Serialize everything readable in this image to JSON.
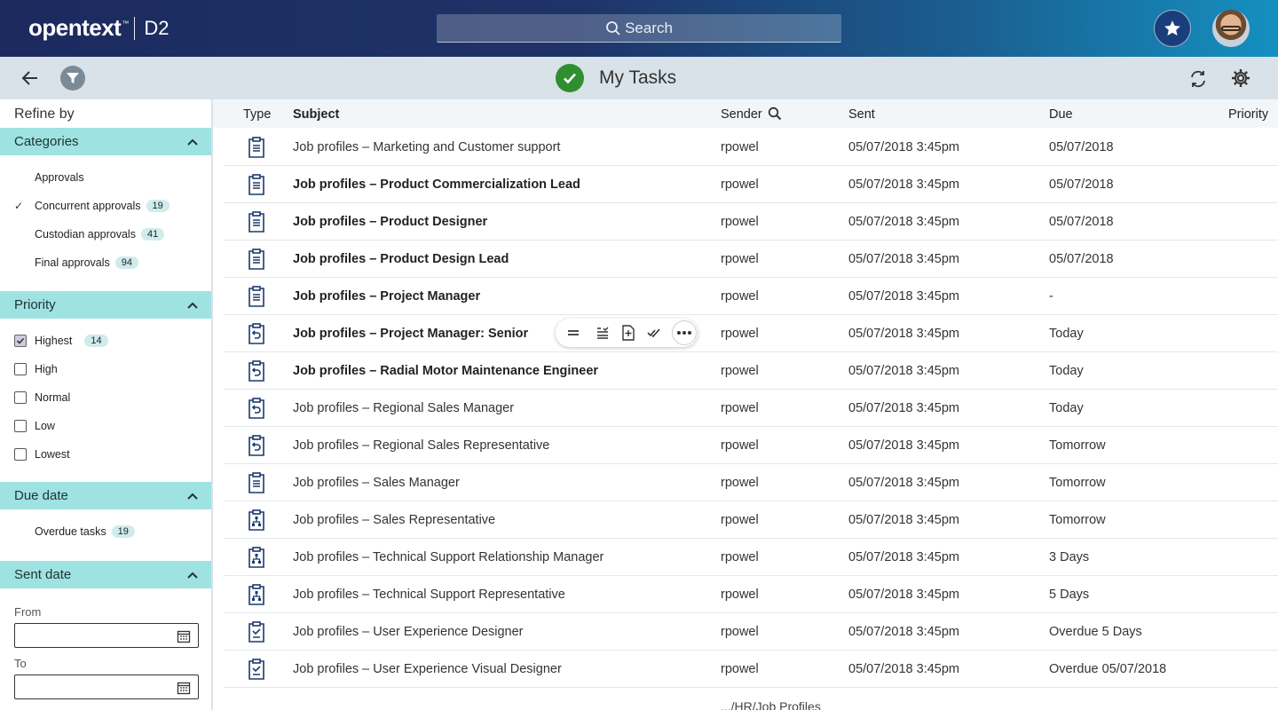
{
  "header": {
    "brand": "opentext",
    "trademark": "™",
    "product": "D2",
    "search_placeholder": "Search"
  },
  "toolbar": {
    "title": "My Tasks"
  },
  "sidebar": {
    "refine_by": "Refine by",
    "categories": {
      "title": "Categories",
      "items": [
        {
          "label": "Approvals",
          "count": null,
          "checked": false
        },
        {
          "label": "Concurrent approvals",
          "count": "19",
          "checked": true
        },
        {
          "label": "Custodian approvals",
          "count": "41",
          "checked": false
        },
        {
          "label": "Final approvals",
          "count": "94",
          "checked": false
        }
      ]
    },
    "priority": {
      "title": "Priority",
      "items": [
        {
          "label": "Highest",
          "count": "14",
          "checked": true
        },
        {
          "label": "High",
          "count": null,
          "checked": false
        },
        {
          "label": "Normal",
          "count": null,
          "checked": false
        },
        {
          "label": "Low",
          "count": null,
          "checked": false
        },
        {
          "label": "Lowest",
          "count": null,
          "checked": false
        }
      ]
    },
    "due_date": {
      "title": "Due date",
      "items": [
        {
          "label": "Overdue tasks",
          "count": "19"
        }
      ]
    },
    "sent_date": {
      "title": "Sent date",
      "from_label": "From",
      "to_label": "To",
      "from_value": "",
      "to_value": ""
    }
  },
  "table": {
    "columns": {
      "type": "Type",
      "subject": "Subject",
      "sender": "Sender",
      "sent": "Sent",
      "due": "Due",
      "priority": "Priority"
    },
    "rows": [
      {
        "icon": "clipboard-icon",
        "subject": "Job profiles – Marketing and Customer support",
        "bold": false,
        "sender": "rpowel",
        "sent": "05/07/2018 3:45pm",
        "due": "05/07/2018"
      },
      {
        "icon": "clipboard-icon",
        "subject": "Job profiles – Product Commercialization Lead",
        "bold": true,
        "sender": "rpowel",
        "sent": "05/07/2018 3:45pm",
        "due": "05/07/2018"
      },
      {
        "icon": "clipboard-icon",
        "subject": "Job profiles – Product Designer",
        "bold": true,
        "sender": "rpowel",
        "sent": "05/07/2018 3:45pm",
        "due": "05/07/2018"
      },
      {
        "icon": "clipboard-icon",
        "subject": "Job profiles – Product Design Lead",
        "bold": true,
        "sender": "rpowel",
        "sent": "05/07/2018 3:45pm",
        "due": "05/07/2018"
      },
      {
        "icon": "clipboard-icon",
        "subject": "Job profiles – Project Manager",
        "bold": true,
        "sender": "rpowel",
        "sent": "05/07/2018 3:45pm",
        "due": "-"
      },
      {
        "icon": "clipboard-return-icon",
        "subject": "Job profiles – Project Manager: Senior",
        "bold": true,
        "sender": "rpowel",
        "sent": "05/07/2018 3:45pm",
        "due": "Today"
      },
      {
        "icon": "clipboard-return-icon",
        "subject": "Job profiles – Radial Motor Maintenance Engineer",
        "bold": true,
        "sender": "rpowel",
        "sent": "05/07/2018 3:45pm",
        "due": "Today"
      },
      {
        "icon": "clipboard-return-icon",
        "subject": "Job profiles – Regional Sales Manager",
        "bold": false,
        "sender": "rpowel",
        "sent": "05/07/2018 3:45pm",
        "due": "Today"
      },
      {
        "icon": "clipboard-return-icon",
        "subject": "Job profiles – Regional Sales Representative",
        "bold": false,
        "sender": "rpowel",
        "sent": "05/07/2018 3:45pm",
        "due": "Tomorrow"
      },
      {
        "icon": "clipboard-icon",
        "subject": "Job profiles – Sales Manager",
        "bold": false,
        "sender": "rpowel",
        "sent": "05/07/2018 3:45pm",
        "due": "Tomorrow"
      },
      {
        "icon": "clipboard-workflow-icon",
        "subject": "Job profiles – Sales Representative",
        "bold": false,
        "sender": "rpowel",
        "sent": "05/07/2018 3:45pm",
        "due": "Tomorrow"
      },
      {
        "icon": "clipboard-workflow-icon",
        "subject": "Job profiles – Technical Support Relationship Manager",
        "bold": false,
        "sender": "rpowel",
        "sent": "05/07/2018 3:45pm",
        "due": "3 Days"
      },
      {
        "icon": "clipboard-workflow-icon",
        "subject": "Job profiles – Technical Support Representative",
        "bold": false,
        "sender": "rpowel",
        "sent": "05/07/2018 3:45pm",
        "due": "5 Days"
      },
      {
        "icon": "clipboard-check-icon",
        "subject": "Job profiles – User Experience Designer",
        "bold": false,
        "sender": "rpowel",
        "sent": "05/07/2018 3:45pm",
        "due": "Overdue 5 Days"
      },
      {
        "icon": "clipboard-check-icon",
        "subject": "Job profiles – User Experience Visual Designer",
        "bold": false,
        "sender": "rpowel",
        "sent": "05/07/2018 3:45pm",
        "due": "Overdue 05/07/2018"
      }
    ],
    "partial_path": ".../HR/Job Profiles"
  },
  "row_actions": [
    "properties-icon",
    "list-icon",
    "add-document-icon",
    "complete-icon",
    "more-icon"
  ],
  "colors": {
    "header_gradient_start": "#1c2a5e",
    "header_gradient_end": "#1490c0",
    "section_header": "#9fe2e2",
    "accent_green": "#2f8f2f",
    "subbar": "#d9e2e8"
  }
}
